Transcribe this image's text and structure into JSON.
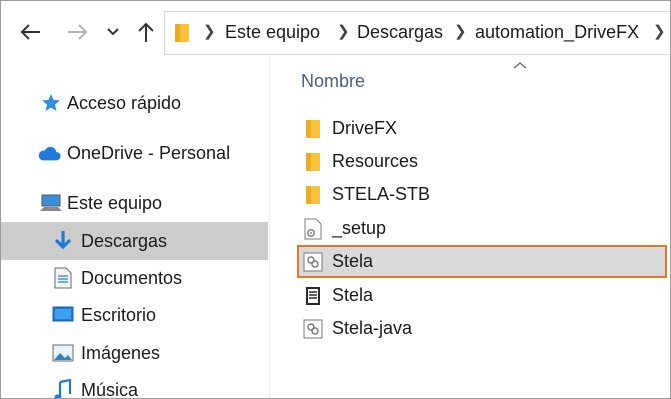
{
  "toolbar": {
    "back_icon": "back-arrow-icon",
    "forward_icon": "forward-arrow-icon",
    "recent_icon": "chevron-down-icon",
    "up_icon": "up-arrow-icon"
  },
  "breadcrumb": [
    "Este equipo",
    "Descargas",
    "automation_DriveFX"
  ],
  "nav": {
    "items": [
      {
        "label": "Acceso rápido",
        "icon": "star-icon"
      },
      {
        "label": "OneDrive - Personal",
        "icon": "cloud-icon"
      },
      {
        "label": "Este equipo",
        "icon": "computer-icon"
      },
      {
        "label": "Descargas",
        "icon": "download-icon"
      },
      {
        "label": "Documentos",
        "icon": "document-icon"
      },
      {
        "label": "Escritorio",
        "icon": "desktop-icon"
      },
      {
        "label": "Imágenes",
        "icon": "image-icon"
      },
      {
        "label": "Música",
        "icon": "music-icon"
      }
    ]
  },
  "content": {
    "column_header": "Nombre",
    "files": [
      {
        "name": "DriveFX",
        "icon": "folder-icon"
      },
      {
        "name": "Resources",
        "icon": "folder-icon"
      },
      {
        "name": "STELA-STB",
        "icon": "folder-icon"
      },
      {
        "name": "_setup",
        "icon": "settings-file-icon"
      },
      {
        "name": "Stela",
        "icon": "script-file-icon"
      },
      {
        "name": "Stela",
        "icon": "executable-file-icon"
      },
      {
        "name": "Stela-java",
        "icon": "script-file-icon"
      }
    ]
  },
  "colors": {
    "selected_nav": "#cccccc",
    "highlight_border": "#e07a25",
    "folder": "#f8c33a",
    "accent_blue": "#1e7ad6"
  }
}
